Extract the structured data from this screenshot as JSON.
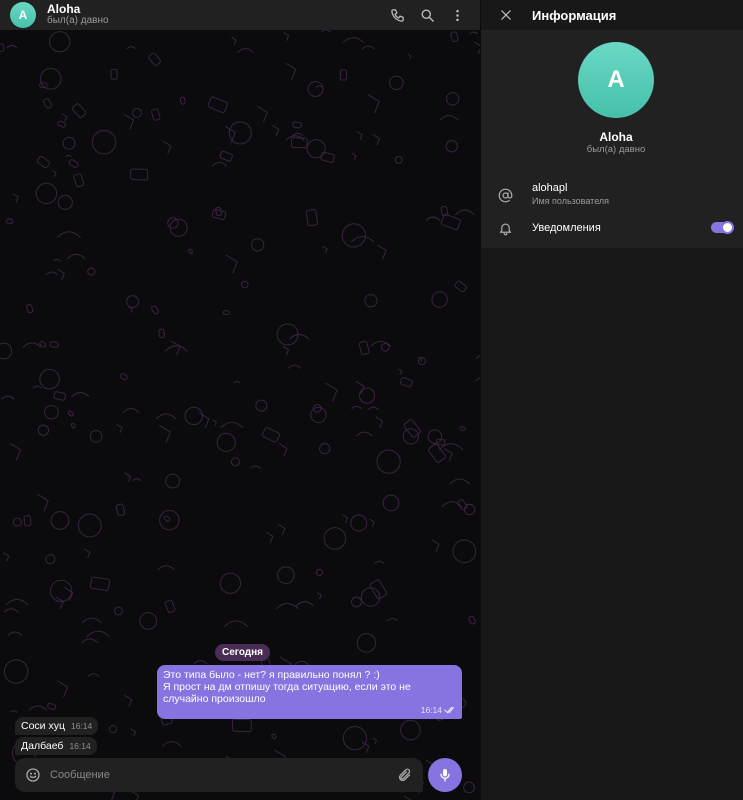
{
  "chat": {
    "header": {
      "avatar_letter": "A",
      "name": "Aloha",
      "status": "был(а) давно",
      "icons": [
        "phone-icon",
        "search-icon",
        "more-vertical-icon"
      ]
    },
    "date_badge": "Сегодня",
    "messages": [
      {
        "direction": "out",
        "lines": [
          "Это типа было - нет? я правильно понял ? :)",
          "Я прост на дм отпишу тогда ситуацию, если это не случайно произошло"
        ],
        "time": "16:14",
        "read": true
      },
      {
        "direction": "in",
        "text": "Соси хуц",
        "time": "16:14"
      },
      {
        "direction": "in",
        "text": "Далбаеб",
        "time": "16:14"
      }
    ],
    "composer": {
      "placeholder": "Сообщение",
      "icons": [
        "emoji-icon",
        "attach-icon",
        "microphone-icon"
      ]
    }
  },
  "info_panel": {
    "title": "Информация",
    "avatar_letter": "A",
    "name": "Aloha",
    "status": "был(а) давно",
    "username": "alohapl",
    "username_label": "Имя пользователя",
    "notifications_label": "Уведомления",
    "notifications_enabled": true
  },
  "colors": {
    "accent": "#8774e1",
    "avatar": "#5ccdb8",
    "panel": "#212121",
    "background": "#0b0b0d",
    "pattern": "#3a2340"
  }
}
